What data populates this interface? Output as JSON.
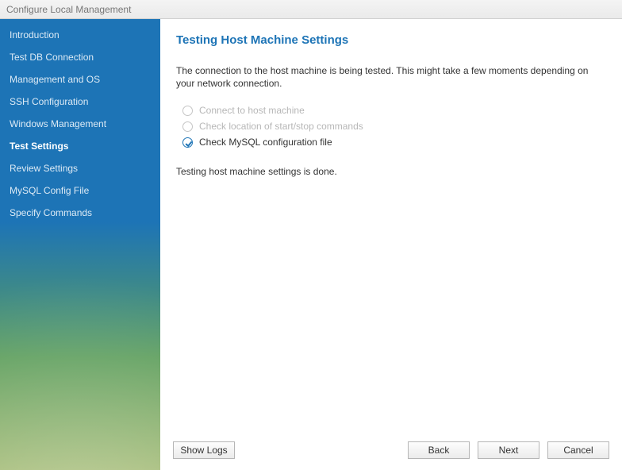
{
  "window": {
    "title": "Configure Local Management"
  },
  "sidebar": {
    "items": [
      {
        "label": "Introduction",
        "active": false
      },
      {
        "label": "Test DB Connection",
        "active": false
      },
      {
        "label": "Management and OS",
        "active": false
      },
      {
        "label": "SSH Configuration",
        "active": false
      },
      {
        "label": "Windows Management",
        "active": false
      },
      {
        "label": "Test Settings",
        "active": true
      },
      {
        "label": "Review Settings",
        "active": false
      },
      {
        "label": "MySQL Config File",
        "active": false
      },
      {
        "label": "Specify Commands",
        "active": false
      }
    ]
  },
  "main": {
    "title": "Testing Host Machine Settings",
    "description": "The connection to the host machine is being tested. This might take a few moments depending on your network connection.",
    "checks": [
      {
        "label": "Connect to host machine",
        "state": "pending"
      },
      {
        "label": "Check location of start/stop commands",
        "state": "pending"
      },
      {
        "label": "Check MySQL configuration file",
        "state": "done"
      }
    ],
    "status": "Testing host machine settings is done."
  },
  "footer": {
    "show_logs": "Show Logs",
    "back": "Back",
    "next": "Next",
    "cancel": "Cancel"
  }
}
